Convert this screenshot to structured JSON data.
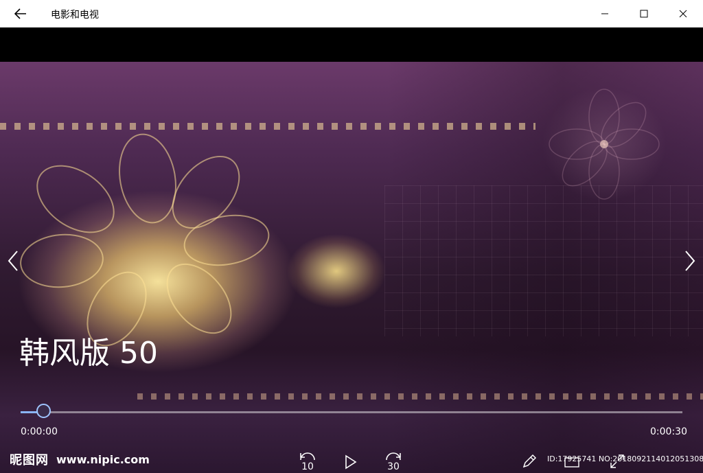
{
  "window": {
    "title": "电影和电视",
    "back_icon": "arrow-left-icon",
    "minimize_icon": "minimize-icon",
    "maximize_icon": "maximize-icon",
    "close_icon": "close-icon"
  },
  "video": {
    "title": "韩风版 50",
    "accent_color": "#8ab4f8",
    "nav_prev_icon": "chevron-left-icon",
    "nav_next_icon": "chevron-right-icon"
  },
  "playback": {
    "current_time": "0:00:00",
    "total_time": "0:00:30",
    "progress_fraction": 0.036,
    "replay_seconds": "10",
    "skip_seconds": "30",
    "play_icon": "play-icon",
    "replay_icon": "replay-10-icon",
    "skip_icon": "skip-30-icon",
    "edit_icon": "pencil-icon",
    "cast_icon": "cast-icon",
    "fullscreen_icon": "fullscreen-icon"
  },
  "watermark": {
    "logo": "昵图网",
    "url": "www.nipic.com",
    "id_text": "ID:17925741 NO:20180921140120513085"
  }
}
